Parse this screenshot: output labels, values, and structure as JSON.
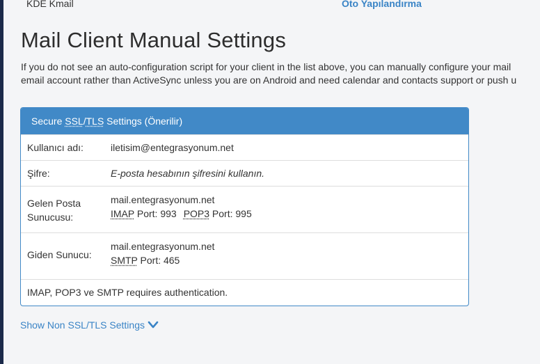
{
  "top": {
    "left_item": "KDE Kmail",
    "right_link": "Oto Yapılandırma"
  },
  "main": {
    "title": "Mail Client Manual Settings",
    "description_line1": "If you do not see an auto-configuration script for your client in the list above, you can manually configure your mail",
    "description_line2": "email account rather than ActiveSync unless you are on Android and need calendar and contacts support or push u"
  },
  "panel": {
    "header_prefix": "Secure ",
    "header_abbr1": "SSL",
    "header_sep": "/",
    "header_abbr2": "TLS",
    "header_suffix": " Settings (Önerilir)",
    "username_label": "Kullanıcı adı:",
    "username_value": "iletisim@entegrasyonum.net",
    "password_label": "Şifre:",
    "password_value": "E-posta hesabının şifresini kullanın.",
    "incoming_label": "Gelen Posta Sunucusu:",
    "incoming_host": "mail.entegrasyonum.net",
    "imap_abbr": "IMAP",
    "imap_port": " Port: 993",
    "pop3_abbr": "POP3",
    "pop3_port": " Port: 995",
    "outgoing_label": "Giden Sunucu:",
    "outgoing_host": "mail.entegrasyonum.net",
    "smtp_abbr": "SMTP",
    "smtp_port": " Port: 465",
    "auth_note": "IMAP, POP3 ve SMTP requires authentication."
  },
  "show_non_ssl": {
    "label": "Show Non SSL/TLS Settings",
    "icon": "chevron-down-icon"
  },
  "colors": {
    "accent": "#4189c7",
    "link": "#3a84c6",
    "sidebar": "#1b2a4a"
  }
}
